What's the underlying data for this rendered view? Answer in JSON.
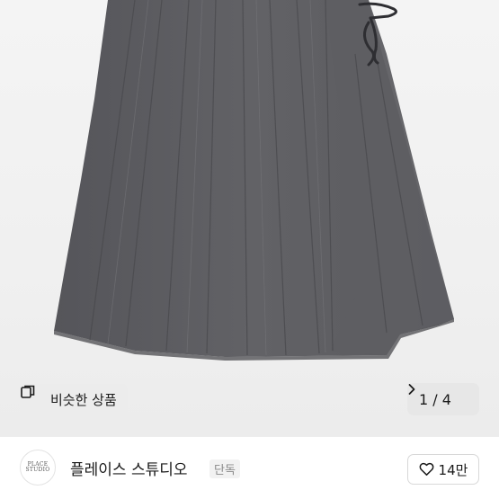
{
  "product_image": {
    "icon": "pleated-skirt-photo"
  },
  "similar_button": {
    "label": "비슷한 상품",
    "icon": "similar-items-icon"
  },
  "pager": {
    "current": "1",
    "separator": "/",
    "total": "4",
    "icon": "chevron-right-icon"
  },
  "seller": {
    "avatar_text": "PLACE STUDIO",
    "name": "플레이스 스튜디오",
    "badge": "단독",
    "like_count": "14만",
    "like_icon": "heart-outline-icon"
  },
  "colors": {
    "skirt": "#5c5c60",
    "background": "#f2f2f2"
  }
}
